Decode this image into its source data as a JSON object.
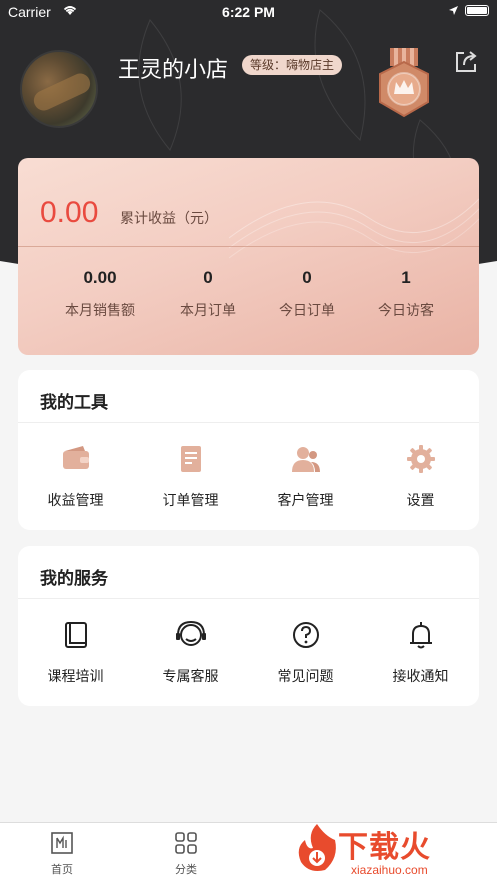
{
  "status_bar": {
    "carrier": "Carrier",
    "time": "6:22 PM"
  },
  "header": {
    "shop_name": "王灵的小店",
    "level": "等级：嗨物店主"
  },
  "earnings": {
    "total": "0.00",
    "total_label": "累计收益（元）",
    "stats": [
      {
        "value": "0.00",
        "label": "本月销售额"
      },
      {
        "value": "0",
        "label": "本月订单"
      },
      {
        "value": "0",
        "label": "今日订单"
      },
      {
        "value": "1",
        "label": "今日访客"
      }
    ]
  },
  "tools": {
    "title": "我的工具",
    "items": [
      {
        "label": "收益管理",
        "icon": "wallet-icon"
      },
      {
        "label": "订单管理",
        "icon": "order-icon"
      },
      {
        "label": "客户管理",
        "icon": "customers-icon"
      },
      {
        "label": "设置",
        "icon": "gear-icon"
      }
    ]
  },
  "services": {
    "title": "我的服务",
    "items": [
      {
        "label": "课程培训",
        "icon": "book-icon"
      },
      {
        "label": "专属客服",
        "icon": "headset-icon"
      },
      {
        "label": "常见问题",
        "icon": "question-icon"
      },
      {
        "label": "接收通知",
        "icon": "bell-icon"
      }
    ]
  },
  "tabbar": {
    "tabs": [
      {
        "label": "首页"
      },
      {
        "label": "分类"
      }
    ]
  },
  "watermark": {
    "text": "下载火",
    "sub": "xiazaihuo.com"
  },
  "colors": {
    "accent": "#e94a3f",
    "header_bg": "#2b2b2d",
    "tool_icon": "#d9a48f",
    "watermark": "#e84b2d"
  }
}
